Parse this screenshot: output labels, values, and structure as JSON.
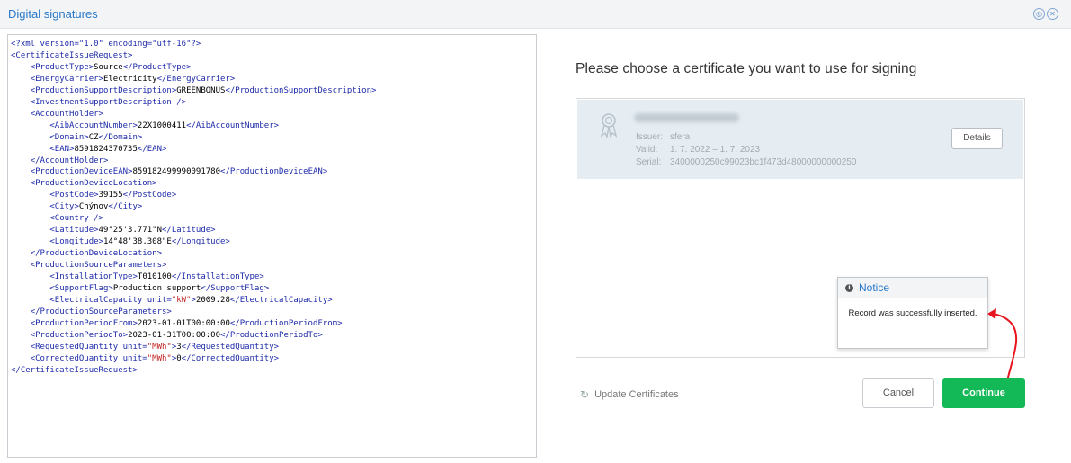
{
  "window": {
    "title": "Digital signatures"
  },
  "xml_lines": [
    {
      "indent": 0,
      "parts": [
        {
          "c": "t",
          "v": "<?xml version=\"1.0\" encoding=\"utf-16\"?>"
        }
      ]
    },
    {
      "indent": 0,
      "parts": [
        {
          "c": "t",
          "v": "<CertificateIssueRequest>"
        }
      ]
    },
    {
      "indent": 1,
      "parts": [
        {
          "c": "t",
          "v": "<ProductType>"
        },
        {
          "c": "x",
          "v": "Source"
        },
        {
          "c": "t",
          "v": "</ProductType>"
        }
      ]
    },
    {
      "indent": 1,
      "parts": [
        {
          "c": "t",
          "v": "<EnergyCarrier>"
        },
        {
          "c": "x",
          "v": "Electricity"
        },
        {
          "c": "t",
          "v": "</EnergyCarrier>"
        }
      ]
    },
    {
      "indent": 1,
      "parts": [
        {
          "c": "t",
          "v": "<ProductionSupportDescription>"
        },
        {
          "c": "x",
          "v": "GREENBONUS"
        },
        {
          "c": "t",
          "v": "</ProductionSupportDescription>"
        }
      ]
    },
    {
      "indent": 1,
      "parts": [
        {
          "c": "t",
          "v": "<InvestmentSupportDescription />"
        }
      ]
    },
    {
      "indent": 1,
      "parts": [
        {
          "c": "t",
          "v": "<AccountHolder>"
        }
      ]
    },
    {
      "indent": 2,
      "parts": [
        {
          "c": "t",
          "v": "<AibAccountNumber>"
        },
        {
          "c": "x",
          "v": "22X1000411"
        },
        {
          "c": "t",
          "v": "</AibAccountNumber>"
        }
      ]
    },
    {
      "indent": 2,
      "parts": [
        {
          "c": "t",
          "v": "<Domain>"
        },
        {
          "c": "x",
          "v": "CZ"
        },
        {
          "c": "t",
          "v": "</Domain>"
        }
      ]
    },
    {
      "indent": 2,
      "parts": [
        {
          "c": "t",
          "v": "<EAN>"
        },
        {
          "c": "x",
          "v": "8591824370735"
        },
        {
          "c": "t",
          "v": "</EAN>"
        }
      ]
    },
    {
      "indent": 1,
      "parts": [
        {
          "c": "t",
          "v": "</AccountHolder>"
        }
      ]
    },
    {
      "indent": 1,
      "parts": [
        {
          "c": "t",
          "v": "<ProductionDeviceEAN>"
        },
        {
          "c": "x",
          "v": "859182499990091780"
        },
        {
          "c": "t",
          "v": "</ProductionDeviceEAN>"
        }
      ]
    },
    {
      "indent": 1,
      "parts": [
        {
          "c": "t",
          "v": "<ProductionDeviceLocation>"
        }
      ]
    },
    {
      "indent": 2,
      "parts": [
        {
          "c": "t",
          "v": "<PostCode>"
        },
        {
          "c": "x",
          "v": "39155"
        },
        {
          "c": "t",
          "v": "</PostCode>"
        }
      ]
    },
    {
      "indent": 2,
      "parts": [
        {
          "c": "t",
          "v": "<City>"
        },
        {
          "c": "x",
          "v": "Chýnov"
        },
        {
          "c": "t",
          "v": "</City>"
        }
      ]
    },
    {
      "indent": 2,
      "parts": [
        {
          "c": "t",
          "v": "<Country />"
        }
      ]
    },
    {
      "indent": 2,
      "parts": [
        {
          "c": "t",
          "v": "<Latitude>"
        },
        {
          "c": "x",
          "v": "49°25'3.771\"N"
        },
        {
          "c": "t",
          "v": "</Latitude>"
        }
      ]
    },
    {
      "indent": 2,
      "parts": [
        {
          "c": "t",
          "v": "<Longitude>"
        },
        {
          "c": "x",
          "v": "14°48'38.308\"E"
        },
        {
          "c": "t",
          "v": "</Longitude>"
        }
      ]
    },
    {
      "indent": 1,
      "parts": [
        {
          "c": "t",
          "v": "</ProductionDeviceLocation>"
        }
      ]
    },
    {
      "indent": 1,
      "parts": [
        {
          "c": "t",
          "v": "<ProductionSourceParameters>"
        }
      ]
    },
    {
      "indent": 2,
      "parts": [
        {
          "c": "t",
          "v": "<InstallationType>"
        },
        {
          "c": "x",
          "v": "T010100"
        },
        {
          "c": "t",
          "v": "</InstallationType>"
        }
      ]
    },
    {
      "indent": 2,
      "parts": [
        {
          "c": "t",
          "v": "<SupportFlag>"
        },
        {
          "c": "x",
          "v": "Production support"
        },
        {
          "c": "t",
          "v": "</SupportFlag>"
        }
      ]
    },
    {
      "indent": 2,
      "parts": [
        {
          "c": "t",
          "v": "<ElectricalCapacity unit="
        },
        {
          "c": "a",
          "v": "\"kW\""
        },
        {
          "c": "t",
          "v": ">"
        },
        {
          "c": "x",
          "v": "2009.28"
        },
        {
          "c": "t",
          "v": "</ElectricalCapacity>"
        }
      ]
    },
    {
      "indent": 1,
      "parts": [
        {
          "c": "t",
          "v": "</ProductionSourceParameters>"
        }
      ]
    },
    {
      "indent": 1,
      "parts": [
        {
          "c": "t",
          "v": "<ProductionPeriodFrom>"
        },
        {
          "c": "x",
          "v": "2023-01-01T00:00:00"
        },
        {
          "c": "t",
          "v": "</ProductionPeriodFrom>"
        }
      ]
    },
    {
      "indent": 1,
      "parts": [
        {
          "c": "t",
          "v": "<ProductionPeriodTo>"
        },
        {
          "c": "x",
          "v": "2023-01-31T00:00:00"
        },
        {
          "c": "t",
          "v": "</ProductionPeriodTo>"
        }
      ]
    },
    {
      "indent": 1,
      "parts": [
        {
          "c": "t",
          "v": "<RequestedQuantity unit="
        },
        {
          "c": "a",
          "v": "\"MWh\""
        },
        {
          "c": "t",
          "v": ">"
        },
        {
          "c": "x",
          "v": "3"
        },
        {
          "c": "t",
          "v": "</RequestedQuantity>"
        }
      ]
    },
    {
      "indent": 1,
      "parts": [
        {
          "c": "t",
          "v": "<CorrectedQuantity unit="
        },
        {
          "c": "a",
          "v": "\"MWh\""
        },
        {
          "c": "t",
          "v": ">"
        },
        {
          "c": "x",
          "v": "0"
        },
        {
          "c": "t",
          "v": "</CorrectedQuantity>"
        }
      ]
    },
    {
      "indent": 0,
      "parts": [
        {
          "c": "t",
          "v": "</CertificateIssueRequest>"
        }
      ]
    }
  ],
  "signing": {
    "heading": "Please choose a certificate you want to use for signing",
    "certificate": {
      "issuer_label": "Issuer:",
      "issuer": "sfera",
      "valid_label": "Valid:",
      "valid": "1. 7. 2022  –  1. 7. 2023",
      "serial_label": "Serial:",
      "serial": "3400000250c99023bc1f473d48000000000250",
      "details_label": "Details"
    },
    "update_label": "Update Certificates",
    "cancel_label": "Cancel",
    "continue_label": "Continue"
  },
  "notice": {
    "title": "Notice",
    "message": "Record was successfully inserted."
  },
  "colors": {
    "accent": "#2878c8",
    "continue": "#13b857",
    "arrow": "#e8141e",
    "xml_tag": "#1d2aa8",
    "xml_attr": "#c02020"
  }
}
